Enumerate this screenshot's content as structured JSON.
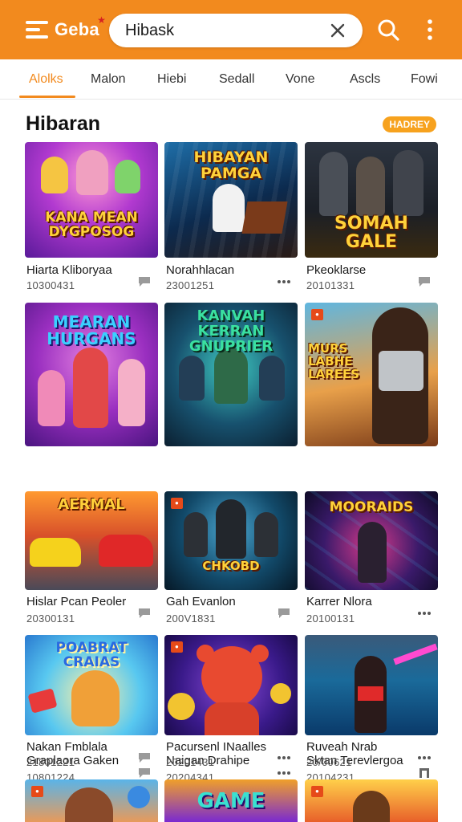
{
  "app": {
    "name": "Geba"
  },
  "search": {
    "value": "Hibask"
  },
  "icons": {
    "logo": "menu-lines-icon",
    "clear": "close-icon",
    "search": "search-icon",
    "menu": "kebab-menu-icon",
    "accent": "#f28a1e"
  },
  "tabs": [
    {
      "label": "Alolks",
      "active": true
    },
    {
      "label": "Malon"
    },
    {
      "label": "Hiebi"
    },
    {
      "label": "Sedall"
    },
    {
      "label": "Vone"
    },
    {
      "label": "Ascls"
    },
    {
      "label": "Fowi"
    }
  ],
  "section": {
    "title": "Hibaran",
    "badge": "HADREY"
  },
  "cards": [
    {
      "art_text": "KANA MEAN DYGPOSOG",
      "title": "Hiarta Kliboryaa",
      "meta": "10300431",
      "icon": "comment-icon"
    },
    {
      "art_text": "HIBAYAN PAMGA",
      "title": "Norahhlacan",
      "meta": "23001251",
      "icon": "more-dots-icon"
    },
    {
      "art_text": "SOMAH GALE",
      "title": "Pkeoklarse",
      "meta": "20101331",
      "icon": "comment-icon"
    },
    {
      "art_text": "MEARAN HURGANS",
      "title": "Graplaora Gaken",
      "meta": "10801224",
      "icon": "comment-icon"
    },
    {
      "art_text": "KANVAH KERRAN GNUPRIER",
      "title": "Naigan Drahipe",
      "meta": "20204341",
      "icon": "more-dots-icon"
    },
    {
      "art_text": "MURS LABHE LAREES",
      "title": "Sktan Terevlergoa",
      "meta": "20104231",
      "icon": "bookmark-icon"
    },
    {
      "art_text": "AERMAL",
      "title": "Hislar Pcan Peoler",
      "meta": "20300131",
      "icon": "comment-icon"
    },
    {
      "art_text": "CHKOBD",
      "title": "Gah Evanlon",
      "meta": "200V1831",
      "icon": "comment-icon"
    },
    {
      "art_text": "MOORAIDS",
      "title": "Karrer Nlora",
      "meta": "20100131",
      "icon": "more-dots-icon"
    },
    {
      "art_text": "POABRAT CRAIAS",
      "title": "Nakan Fmblala",
      "meta": "21801221",
      "icon": "comment-icon"
    },
    {
      "art_text": "",
      "title": "Pacursenl INaalles",
      "meta": "20201431",
      "icon": "more-dots-icon"
    },
    {
      "art_text": "",
      "title": "Ruveah Nrab",
      "meta": "20/00621",
      "icon": "more-dots-icon"
    },
    {
      "art_text": "",
      "title": "",
      "meta": "",
      "icon": ""
    },
    {
      "art_text": "GAME",
      "title": "",
      "meta": "",
      "icon": ""
    },
    {
      "art_text": "",
      "title": "",
      "meta": "",
      "icon": ""
    }
  ]
}
